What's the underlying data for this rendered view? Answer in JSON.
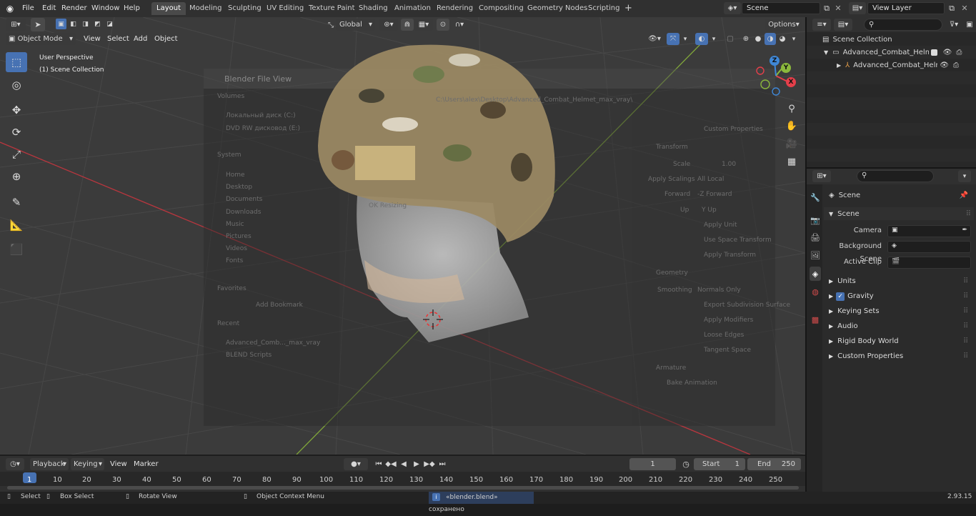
{
  "topbar": {
    "menus": [
      "File",
      "Edit",
      "Render",
      "Window",
      "Help"
    ],
    "workspaces": [
      "Layout",
      "Modeling",
      "Sculpting",
      "UV Editing",
      "Texture Paint",
      "Shading",
      "Animation",
      "Rendering",
      "Compositing",
      "Geometry Nodes",
      "Scripting"
    ],
    "active_workspace": "Layout",
    "add_workspace": "+",
    "scene_name": "Scene",
    "view_layer_name": "View Layer"
  },
  "viewport": {
    "mode": "Object Mode",
    "menus": [
      "View",
      "Select",
      "Add",
      "Object"
    ],
    "transform_orientation": "Global",
    "options_label": "Options",
    "overlay_title": "User Perspective",
    "overlay_subtitle": "(1) Scene Collection",
    "gizmo_axes": {
      "x": "X",
      "y": "Y",
      "z": "Z"
    },
    "gizmo_colors": {
      "x": "#e53f4a",
      "y": "#8bb83c",
      "z": "#3f87d6"
    },
    "ghost_dialog": {
      "title": "Blender File View",
      "path": "C:\\Users\\alex\\Desktop\\Advanced_Combat_Helmet_max_vray\\",
      "sidebar": [
        "Volumes",
        "Локальный диск (C:)",
        "DVD RW дисковод (E:)",
        "System",
        "Home",
        "Desktop",
        "Documents",
        "Downloads",
        "Music",
        "Pictures",
        "Videos",
        "Fonts",
        "Favorites",
        "Add Bookmark",
        "Recent",
        "Advanced_Comb..._max_vray",
        "BLEND Scripts"
      ],
      "settings": [
        "Custom Properties",
        "Transform",
        "Scale",
        "1.00",
        "Apply Scalings",
        "All Local",
        "Forward",
        "-Z Forward",
        "Up",
        "Y Up",
        "Apply Unit",
        "Use Space Transform",
        "Apply Transform",
        "Geometry",
        "Smoothing",
        "Normals Only",
        "Export Subdivision Surface",
        "Apply Modifiers",
        "Loose Edges",
        "Tangent Space",
        "Armature",
        "Bake Animation"
      ],
      "ok_text": "OK  Resizing"
    }
  },
  "outliner": {
    "search_placeholder": "",
    "root": "Scene Collection",
    "items": [
      {
        "label": "Advanced_Combat_Helmet_Y",
        "level": 1
      },
      {
        "label": "Advanced_Combat_Helm",
        "level": 2
      }
    ]
  },
  "properties": {
    "breadcrumb": "Scene",
    "panel_title": "Scene",
    "fields": [
      {
        "label": "Camera",
        "value": ""
      },
      {
        "label": "Background Scene",
        "value": ""
      },
      {
        "label": "Active Clip",
        "value": ""
      }
    ],
    "subpanels": [
      "Units",
      "Gravity",
      "Keying Sets",
      "Audio",
      "Rigid Body World",
      "Custom Properties"
    ],
    "gravity_checked": true
  },
  "timeline": {
    "menus": [
      "Playback",
      "Keying",
      "View",
      "Marker"
    ],
    "current_frame": "1",
    "start_label": "Start",
    "start_value": "1",
    "end_label": "End",
    "end_value": "250",
    "ticks": [
      "1",
      "10",
      "20",
      "30",
      "40",
      "50",
      "60",
      "70",
      "80",
      "90",
      "100",
      "110",
      "120",
      "130",
      "140",
      "150",
      "160",
      "170",
      "180",
      "190",
      "200",
      "210",
      "220",
      "230",
      "240",
      "250"
    ]
  },
  "statusbar": {
    "select": "Select",
    "box_select": "Box Select",
    "rotate_view": "Rotate View",
    "context_menu": "Object Context Menu",
    "message": "«blender.blend» сохранено",
    "version": "2.93.15"
  },
  "colors": {
    "accent": "#4772b3",
    "x_axis_line": "#b8363e",
    "y_axis_line": "#7fa53a"
  }
}
